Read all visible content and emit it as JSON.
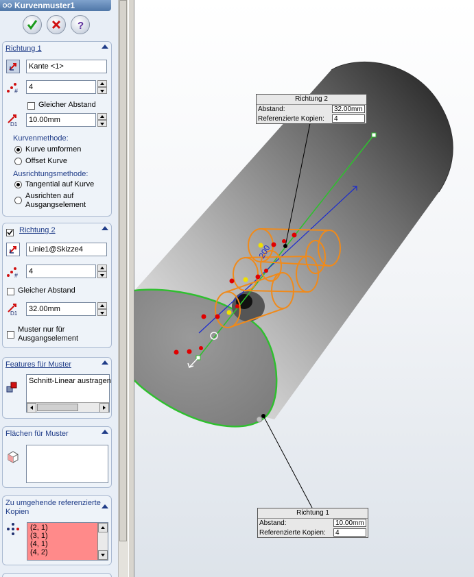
{
  "title": "Kurvenmuster1",
  "actions": {
    "ok": "✔",
    "cancel": "✖",
    "help": "?"
  },
  "richtung1": {
    "header": "Richtung 1",
    "edge_ref": "Kante <1>",
    "count": "4",
    "equal_spacing_label": "Gleicher Abstand",
    "equal_spacing_checked": false,
    "spacing": "10.00mm",
    "curve_method_label": "Kurvenmethode:",
    "curve_methods": [
      "Kurve umformen",
      "Offset Kurve"
    ],
    "curve_method_selected": 0,
    "alignment_label": "Ausrichtungsmethode:",
    "alignment_methods": [
      "Tangential auf Kurve",
      "Ausrichten auf",
      "Ausgangselement"
    ],
    "alignment_selected": 0
  },
  "richtung2": {
    "header": "Richtung 2",
    "enabled": true,
    "edge_ref": "Linie1@Skizze4",
    "count": "4",
    "equal_spacing_label": "Gleicher Abstand",
    "spacing": "32.00mm",
    "seed_only_label_1": "Muster nur für",
    "seed_only_label_2": "Ausgangselement"
  },
  "features": {
    "header": "Features für Muster",
    "items": [
      "Schnitt-Linear austragen"
    ]
  },
  "faces": {
    "header": "Flächen für Muster"
  },
  "skip": {
    "header_1": "Zu umgehende referenzierte",
    "header_2": "Kopien",
    "items": [
      "(2, 1)",
      "(3, 1)",
      "(4, 1)",
      "(4, 2)"
    ]
  },
  "callout_top": {
    "title": "Richtung 2",
    "abstand_label": "Abstand:",
    "abstand_value": "32.00mm",
    "kopien_label": "Referenzierte Kopien:",
    "kopien_value": "4"
  },
  "callout_bottom": {
    "title": "Richtung 1",
    "abstand_label": "Abstand:",
    "abstand_value": "10.00mm",
    "kopien_label": "Referenzierte Kopien:",
    "kopien_value": "4"
  },
  "colors": {
    "panel_bg": "#e8eef6",
    "section_header": "#1f3c88",
    "skip_list_bg": "#ff8a8a",
    "edge_green": "#2fbf2f",
    "pattern_orange": "#f08a1a",
    "axis_blue": "#1a2ad0",
    "marker_red": "#e00000",
    "marker_yellow": "#f0e000"
  },
  "icons": [
    "ok-check-icon",
    "cancel-x-icon",
    "help-icon",
    "direction-arrow-icon",
    "instances-icon",
    "spacing-icon",
    "features-icon",
    "faces-icon",
    "skip-instances-icon"
  ]
}
